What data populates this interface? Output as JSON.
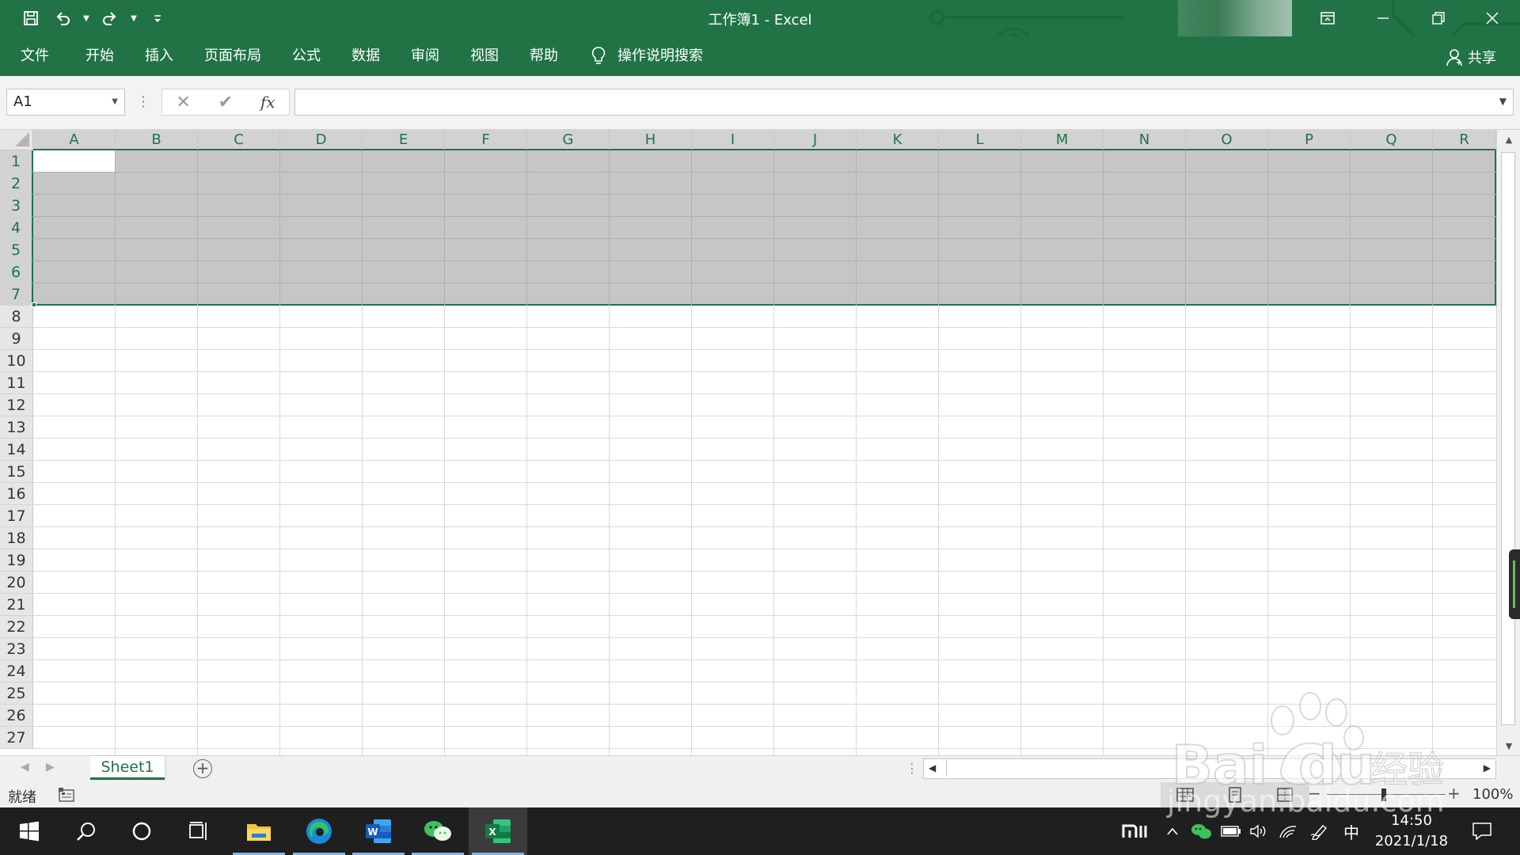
{
  "window": {
    "title": "工作簿1  -  Excel",
    "accent_color": "#217346"
  },
  "quick_access": {
    "save": "save-icon",
    "undo": "undo-icon",
    "redo": "redo-icon",
    "customize": "customize-qat-icon"
  },
  "ribbon": {
    "tabs": [
      "文件",
      "开始",
      "插入",
      "页面布局",
      "公式",
      "数据",
      "审阅",
      "视图",
      "帮助"
    ],
    "tell_me": "操作说明搜索",
    "share": "共享"
  },
  "formula_bar": {
    "name_box": "A1",
    "fx_label": "fx",
    "value": ""
  },
  "grid": {
    "columns": [
      "A",
      "B",
      "C",
      "D",
      "E",
      "F",
      "G",
      "H",
      "I",
      "J",
      "K",
      "L",
      "M",
      "N",
      "O",
      "P",
      "Q",
      "R"
    ],
    "rows": [
      "1",
      "2",
      "3",
      "4",
      "5",
      "6",
      "7",
      "8",
      "9",
      "10",
      "11",
      "12",
      "13",
      "14",
      "15",
      "16",
      "17",
      "18",
      "19",
      "20",
      "21",
      "22",
      "23",
      "24",
      "25",
      "26",
      "27"
    ],
    "selected_rows": "1:7",
    "active_cell": "A1"
  },
  "sheets": {
    "tabs": [
      "Sheet1"
    ],
    "active": "Sheet1"
  },
  "status": {
    "ready": "就绪",
    "zoom": "100%"
  },
  "taskbar": {
    "ime": "中",
    "time": "14:50",
    "date": "2021/1/18"
  },
  "watermark": {
    "url": "jingyan.baidu.com",
    "brand": "Baidu经验"
  }
}
